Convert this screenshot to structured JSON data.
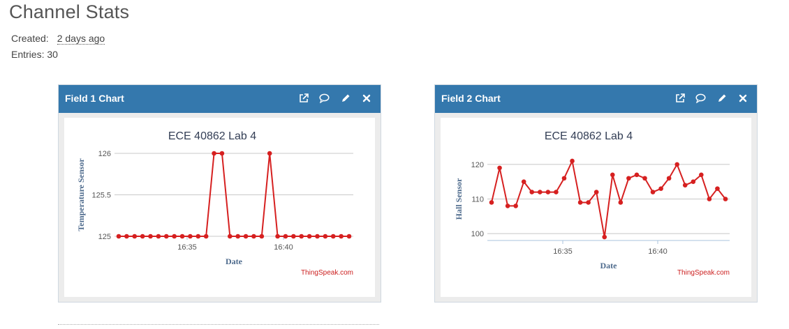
{
  "page": {
    "title": "Channel Stats",
    "created_label": "Created:",
    "created_value": "2 days ago",
    "entries_label": "Entries:",
    "entries_value": "30"
  },
  "panels": [
    {
      "title": "Field 1 Chart",
      "tools": [
        "external-link-icon",
        "comment-icon",
        "pencil-icon",
        "close-icon"
      ]
    },
    {
      "title": "Field 2 Chart",
      "tools": [
        "external-link-icon",
        "comment-icon",
        "pencil-icon",
        "close-icon"
      ]
    }
  ],
  "chart_data": [
    {
      "type": "line",
      "title": "ECE 40862 Lab 4",
      "xlabel": "Date",
      "ylabel": "Temperature Sensor",
      "credit": "ThingSpeak.com",
      "color": "#d62020",
      "x_ticks": [
        "16:35",
        "16:40"
      ],
      "y_ticks": [
        125,
        125.5,
        126
      ],
      "ylim": [
        125,
        126
      ],
      "grid": true,
      "series": [
        {
          "values": [
            125,
            125,
            125,
            125,
            125,
            125,
            125,
            125,
            125,
            125,
            125,
            125,
            126,
            126,
            125,
            125,
            125,
            125,
            125,
            126,
            125,
            125,
            125,
            125,
            125,
            125,
            125,
            125,
            125,
            125
          ]
        }
      ]
    },
    {
      "type": "line",
      "title": "ECE 40862 Lab 4",
      "xlabel": "Date",
      "ylabel": "Hall Sensor",
      "credit": "ThingSpeak.com",
      "color": "#d62020",
      "x_ticks": [
        "16:35",
        "16:40"
      ],
      "y_ticks": [
        100,
        110,
        120
      ],
      "ylim": [
        98,
        122
      ],
      "grid": true,
      "series": [
        {
          "values": [
            109,
            119,
            108,
            108,
            115,
            112,
            112,
            112,
            112,
            116,
            121,
            109,
            109,
            112,
            99,
            117,
            109,
            116,
            117,
            116,
            112,
            113,
            116,
            120,
            114,
            115,
            117,
            110,
            113,
            110
          ]
        }
      ]
    }
  ]
}
